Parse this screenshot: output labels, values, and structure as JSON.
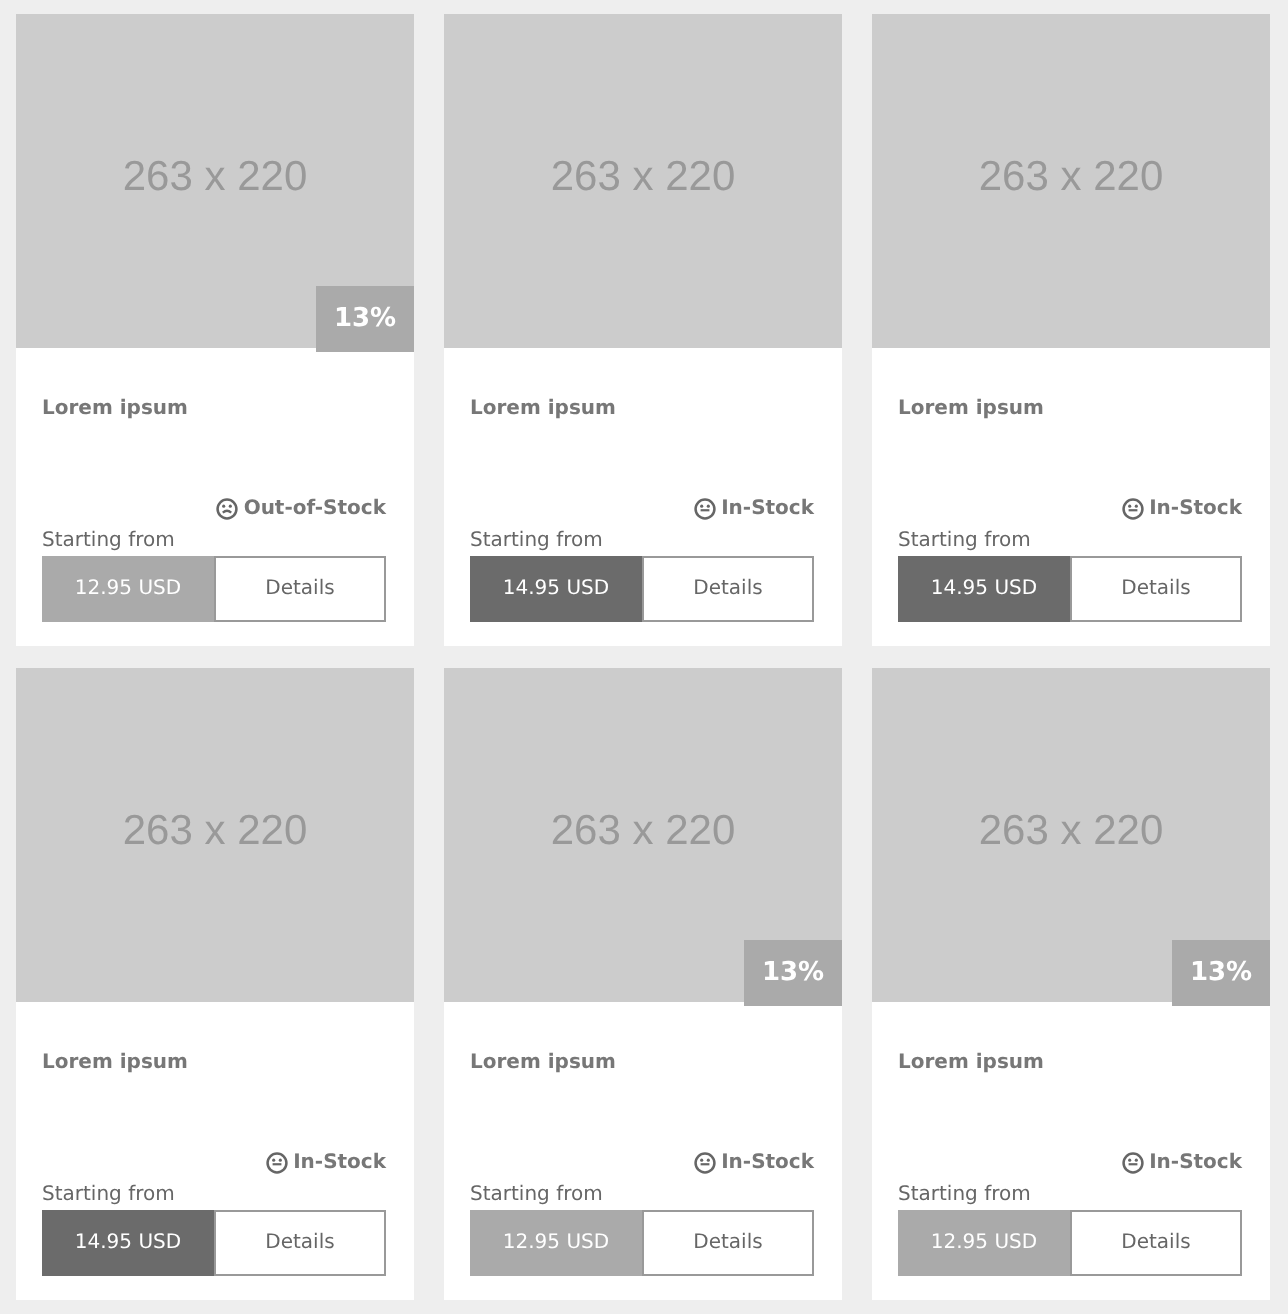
{
  "products": [
    {
      "image_label": "263 x 220",
      "discount": "13%",
      "title": "Lorem ipsum",
      "stock": {
        "kind": "out-of-stock",
        "label": "Out-of-Stock"
      },
      "price_caption": "Starting from",
      "price": "12.95 USD",
      "details": "Details"
    },
    {
      "image_label": "263 x 220",
      "title": "Lorem ipsum",
      "stock": {
        "kind": "in-stock",
        "label": "In-Stock"
      },
      "price_caption": "Starting from",
      "price": "14.95 USD",
      "details": "Details"
    },
    {
      "image_label": "263 x 220",
      "title": "Lorem ipsum",
      "stock": {
        "kind": "in-stock",
        "label": "In-Stock"
      },
      "price_caption": "Starting from",
      "price": "14.95 USD",
      "details": "Details"
    },
    {
      "image_label": "263 x 220",
      "title": "Lorem ipsum",
      "stock": {
        "kind": "in-stock",
        "label": "In-Stock"
      },
      "price_caption": "Starting from",
      "price": "14.95 USD",
      "details": "Details"
    },
    {
      "image_label": "263 x 220",
      "discount": "13%",
      "title": "Lorem ipsum",
      "stock": {
        "kind": "in-stock",
        "label": "In-Stock"
      },
      "price_caption": "Starting from",
      "price": "12.95 USD",
      "details": "Details"
    },
    {
      "image_label": "263 x 220",
      "discount": "13%",
      "title": "Lorem ipsum",
      "stock": {
        "kind": "in-stock",
        "label": "In-Stock"
      },
      "price_caption": "Starting from",
      "price": "12.95 USD",
      "details": "Details"
    }
  ]
}
